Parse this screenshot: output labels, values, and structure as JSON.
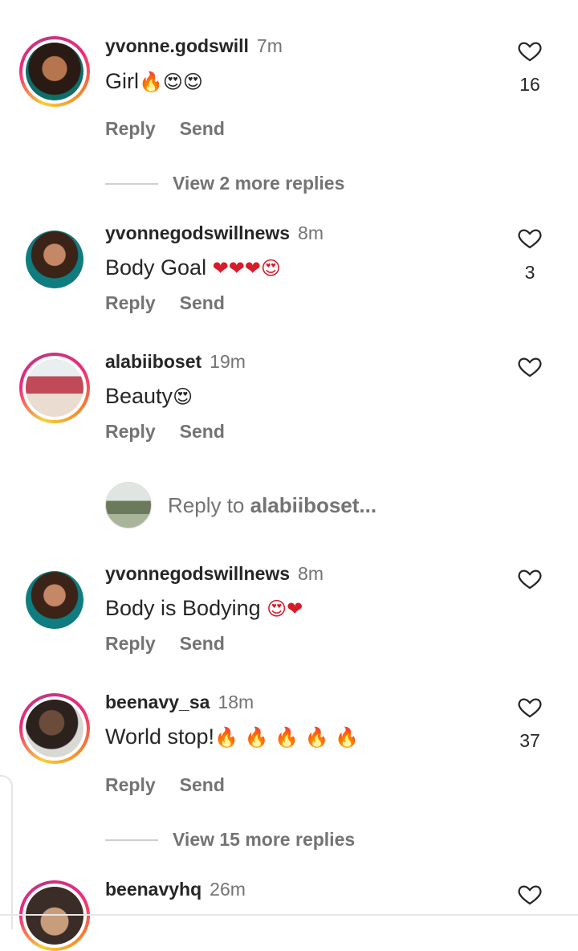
{
  "comments": [
    {
      "username": "yvonne.godswill",
      "time": "7m",
      "text": "Girl",
      "emojis": "🔥😍😍",
      "likes": "16",
      "reply": "Reply",
      "send": "Send",
      "view_more": "View 2 more replies"
    },
    {
      "username": "yvonnegodswillnews",
      "time": "8m",
      "text": "Body Goal ",
      "emojis": "❤❤❤😍",
      "likes": "3",
      "reply": "Reply",
      "send": "Send"
    },
    {
      "username": "alabiiboset",
      "time": "19m",
      "text": "Beauty",
      "emojis": "😍",
      "likes": "",
      "reply": "Reply",
      "send": "Send"
    },
    {
      "username": "yvonnegodswillnews",
      "time": "8m",
      "text": "Body is Bodying ",
      "emojis": "😍❤",
      "likes": "",
      "reply": "Reply",
      "send": "Send"
    },
    {
      "username": "beenavy_sa",
      "time": "18m",
      "text": "World stop!",
      "emojis": "🔥 🔥 🔥 🔥 🔥",
      "likes": "37",
      "reply": "Reply",
      "send": "Send",
      "view_more": "View 15 more replies"
    },
    {
      "username": "beenavyhq",
      "time": "26m"
    }
  ],
  "reply_input": {
    "prefix": "Reply to ",
    "target": "alabiiboset..."
  },
  "colors": {
    "ring_start": "#f9ce34",
    "ring_mid": "#ee2a7b",
    "ring_end": "#c13584",
    "muted": "#737373",
    "text": "#262626"
  },
  "icons": {
    "like": "heart-outline-icon"
  }
}
